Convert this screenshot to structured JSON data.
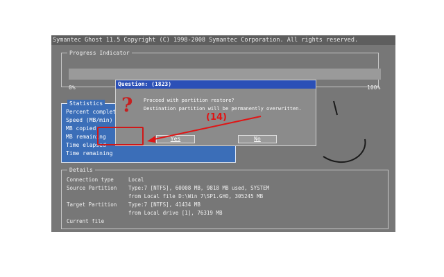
{
  "window": {
    "title": "Symantec Ghost 11.5   Copyright (C) 1998-2008 Symantec Corporation. All rights reserved."
  },
  "progress": {
    "label": "Progress Indicator",
    "value_percent": 0,
    "min_label": "0%",
    "max_label": "100%"
  },
  "statistics": {
    "label": "Statistics",
    "rows": [
      "Percent complete",
      "Speed (MB/min)",
      "MB copied",
      "MB remaining",
      "Time elapsed",
      "Time remaining"
    ]
  },
  "details": {
    "label": "Details",
    "rows": [
      {
        "label": "Connection type",
        "value": "Local"
      },
      {
        "label": "Source Partition",
        "value": "Type:7 [NTFS], 60008 MB, 9818 MB used, SYSTEM"
      },
      {
        "label": "",
        "value": "from Local file D:\\Win 7\\SP1.GHO, 305245 MB"
      },
      {
        "label": "Target Partition",
        "value": "Type:7 [NTFS], 41434 MB"
      },
      {
        "label": "",
        "value": "from Local drive [1], 76319 MB"
      },
      {
        "label": "Current file",
        "value": ""
      }
    ]
  },
  "dialog": {
    "title": "Question: (1823)",
    "message_line1": "Proceed with partition restore?",
    "message_line2": "Destination partition will be permanently overwritten.",
    "yes_label": "Yes",
    "no_label": "No",
    "icon": "question-icon"
  },
  "annotation": {
    "step_label": "(14)",
    "color": "#e01515"
  },
  "colors": {
    "screen_bg": "#777777",
    "stats_bg": "#3b6eb8",
    "dialog_title_bg": "#2b50b7"
  }
}
